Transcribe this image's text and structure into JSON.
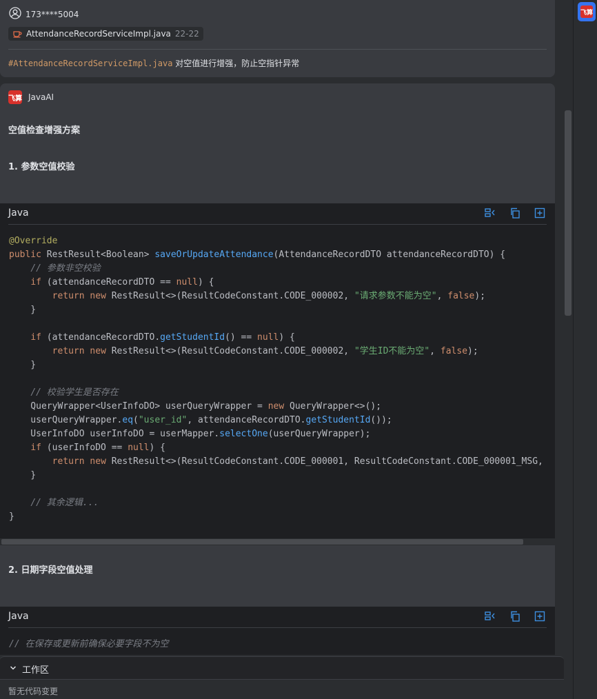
{
  "user_message": {
    "username": "173****5004",
    "file_chip": {
      "name": "AttendanceRecordServiceImpl.java",
      "range": "22-22"
    },
    "ref": "#AttendanceRecordServiceImpl.java",
    "text": "对空值进行增强，防止空指针异常"
  },
  "ai_message": {
    "logo_text": "飞算",
    "author": "JavaAI",
    "title": "空值检查增强方案",
    "section1": "1. 参数空值校验",
    "section2": "2. 日期字段空值处理",
    "code_blocks": [
      {
        "language": "Java"
      },
      {
        "language": "Java",
        "first_line": "// 在保存或更新前确保必要字段不为空"
      }
    ]
  },
  "workspace": {
    "title": "工作区",
    "empty_text": "暂无代码变更"
  },
  "sidebar": {
    "logo_text": "飞算"
  },
  "colors": {
    "background": "#2b2d30",
    "card": "#393b40",
    "code_bg": "#1e1f22",
    "keyword": "#cf8e6d",
    "function": "#56a8f5",
    "string": "#6aab73",
    "comment": "#7a7e85",
    "annotation": "#b3ae60",
    "accent": "#3574f0",
    "brand_red": "#d8312b"
  }
}
